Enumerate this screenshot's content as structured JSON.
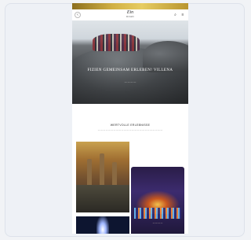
{
  "colors": {
    "gold_bar": "#d1b044",
    "page_background": "#ffffff",
    "frame_background": "#eef1f6"
  },
  "header": {
    "logo_text": "Ein",
    "logo_subtext": "ROAD",
    "back_icon": "chevron-left-icon",
    "search_icon": "search-icon",
    "menu_icon": "menu-icon"
  },
  "hero": {
    "title": "FIZIEN GEMEINSAM ERLEBEN! VILLENA",
    "subtitle": "— — — —"
  },
  "intro": {
    "title": "WERTVOLLE ERLEBNISSE",
    "body": "— — — — — — — — — — — — — — — — — — — — — — — — —"
  },
  "gallery": {
    "items": [
      {
        "image": "castle-landscape-photo"
      },
      {
        "image": "night-concert-photo",
        "caption": "— — — —"
      },
      {
        "image": "stage-spotlight-photo"
      }
    ]
  }
}
